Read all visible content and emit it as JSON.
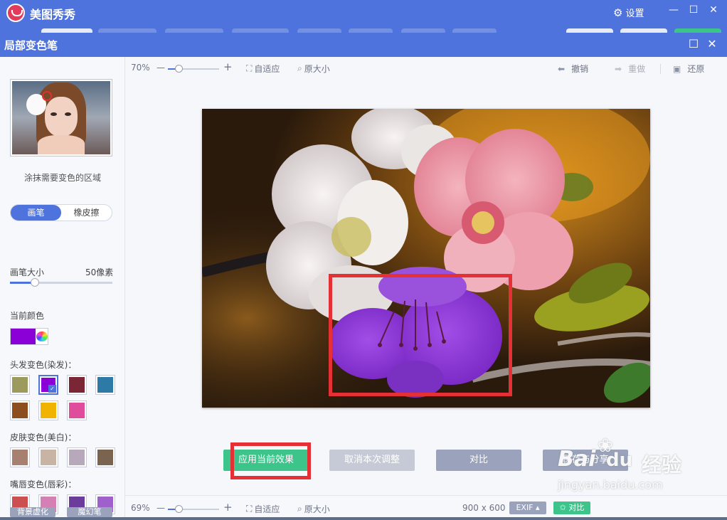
{
  "app": {
    "name": "美图秀秀",
    "settings_label": "设置",
    "minimize": "—",
    "maximize": "☐",
    "close": "✕"
  },
  "dialog": {
    "title": "局部变色笔",
    "maximize": "☐",
    "close": "✕"
  },
  "left_panel": {
    "hint": "涂抹需要变色的区域",
    "tabs": [
      {
        "label": "画笔",
        "active": true
      },
      {
        "label": "橡皮擦",
        "active": false
      }
    ],
    "brush_size_label": "画笔大小",
    "brush_size_value": "50像素",
    "brush_size_level": 0.24,
    "current_color_label": "当前颜色",
    "current_color": "#8c00d8",
    "hair_label": "头发变色(染发)：",
    "hair_colors": [
      "#9c9a5c",
      "#8c00d8",
      "#7a2634",
      "#2e7aa6",
      "#8c4e1e",
      "#f0b400",
      "#e04c9c"
    ],
    "skin_label": "皮肤变色(美白)：",
    "skin_colors": [
      "#a88070",
      "#c8b4a4",
      "#b8a8bc",
      "#7a6450"
    ],
    "lip_label": "嘴唇变色(唇彩)：",
    "lip_colors": [
      "#cc5050",
      "#d480b4",
      "#6c3c9c",
      "#a060cc"
    ],
    "bottom_buttons": [
      "背景虚化",
      "魔幻笔"
    ]
  },
  "toolbar": {
    "zoom": "70%",
    "minus": "—",
    "plus": "+",
    "fit_label": "自适应",
    "original_label": "原大小",
    "undo_label": "撤销",
    "redo_label": "重做",
    "restore_label": "还原"
  },
  "actions": {
    "apply": "应用当前效果",
    "cancel": "取消本次调整",
    "compare": "对比",
    "save_share": "保存与分享"
  },
  "statusbar": {
    "zoom": "69%",
    "minus": "—",
    "plus": "+",
    "fit_label": "自适应",
    "original_label": "原大小",
    "dimensions": "900 x 600",
    "exif": "EXIF ▴",
    "compare": "对比"
  },
  "watermark": {
    "brand": "Bai",
    "paw": "du",
    "suffix": "经验",
    "url": "jingyan.baidu.com"
  },
  "colors": {
    "accent": "#4f73dc",
    "apply_button": "#3cc48a",
    "gray_button": "#c6cad6",
    "compare_button": "#9aa3bb",
    "highlight": "#e53036"
  }
}
